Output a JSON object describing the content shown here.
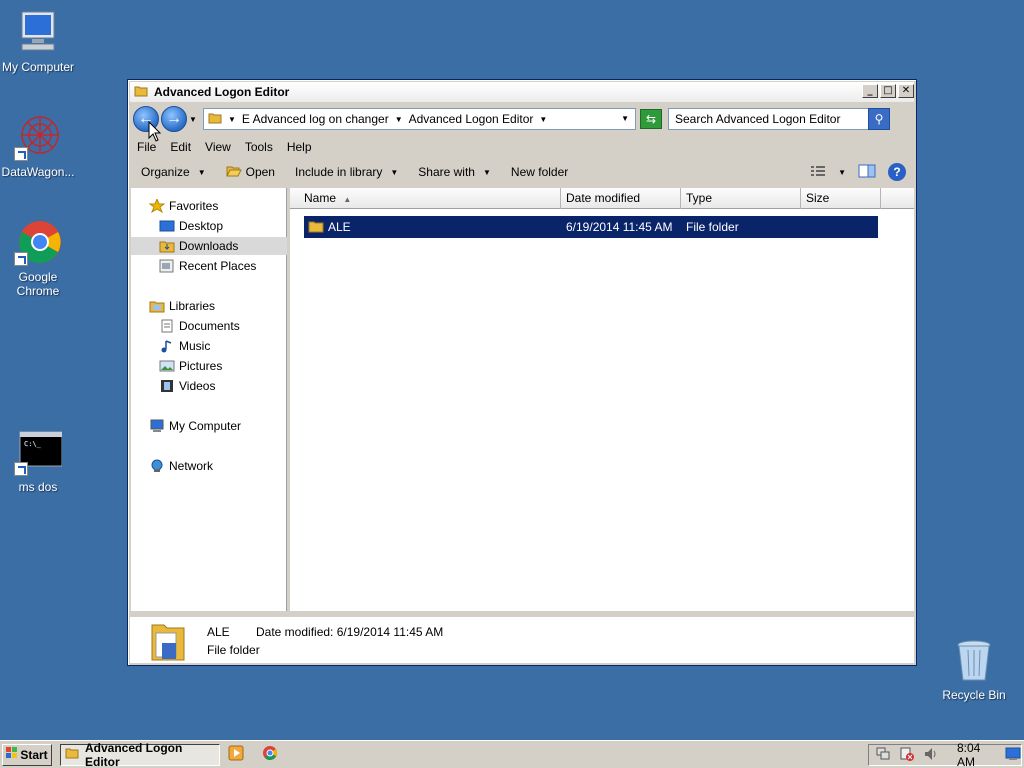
{
  "desktop": {
    "icons": [
      {
        "label": "My Computer"
      },
      {
        "label": "DataWagon..."
      },
      {
        "label": "Google Chrome"
      },
      {
        "label": "ms dos"
      },
      {
        "label": "Recycle Bin"
      }
    ]
  },
  "window": {
    "title": "Advanced Logon Editor",
    "controls": {
      "minimize": "_",
      "maximize": "□",
      "close": "✕"
    },
    "address": {
      "crumbs": [
        "E Advanced log on changer",
        "Advanced Logon Editor"
      ]
    },
    "search": {
      "placeholder": "Search Advanced Logon Editor"
    },
    "menu": [
      "File",
      "Edit",
      "View",
      "Tools",
      "Help"
    ],
    "commands": {
      "organize": "Organize",
      "open": "Open",
      "include": "Include in library",
      "share": "Share with",
      "new_folder": "New folder"
    },
    "nav": {
      "favorites": "Favorites",
      "desktop": "Desktop",
      "downloads": "Downloads",
      "recent": "Recent Places",
      "libraries": "Libraries",
      "documents": "Documents",
      "music": "Music",
      "pictures": "Pictures",
      "videos": "Videos",
      "my_computer": "My Computer",
      "network": "Network"
    },
    "columns": [
      "Name",
      "Date modified",
      "Type",
      "Size"
    ],
    "files": [
      {
        "name": "ALE",
        "date": "6/19/2014 11:45 AM",
        "type": "File folder",
        "size": ""
      }
    ],
    "details": {
      "name": "ALE",
      "date": "Date modified: 6/19/2014 11:45 AM",
      "type": "File folder"
    }
  },
  "taskbar": {
    "start": "Start",
    "active_task": "Advanced Logon Editor",
    "clock": "8:04 AM"
  },
  "colors": {
    "desktop": "#3a6ea5",
    "selection": "#0a246a",
    "nav_selected": "#d9d9d9"
  }
}
